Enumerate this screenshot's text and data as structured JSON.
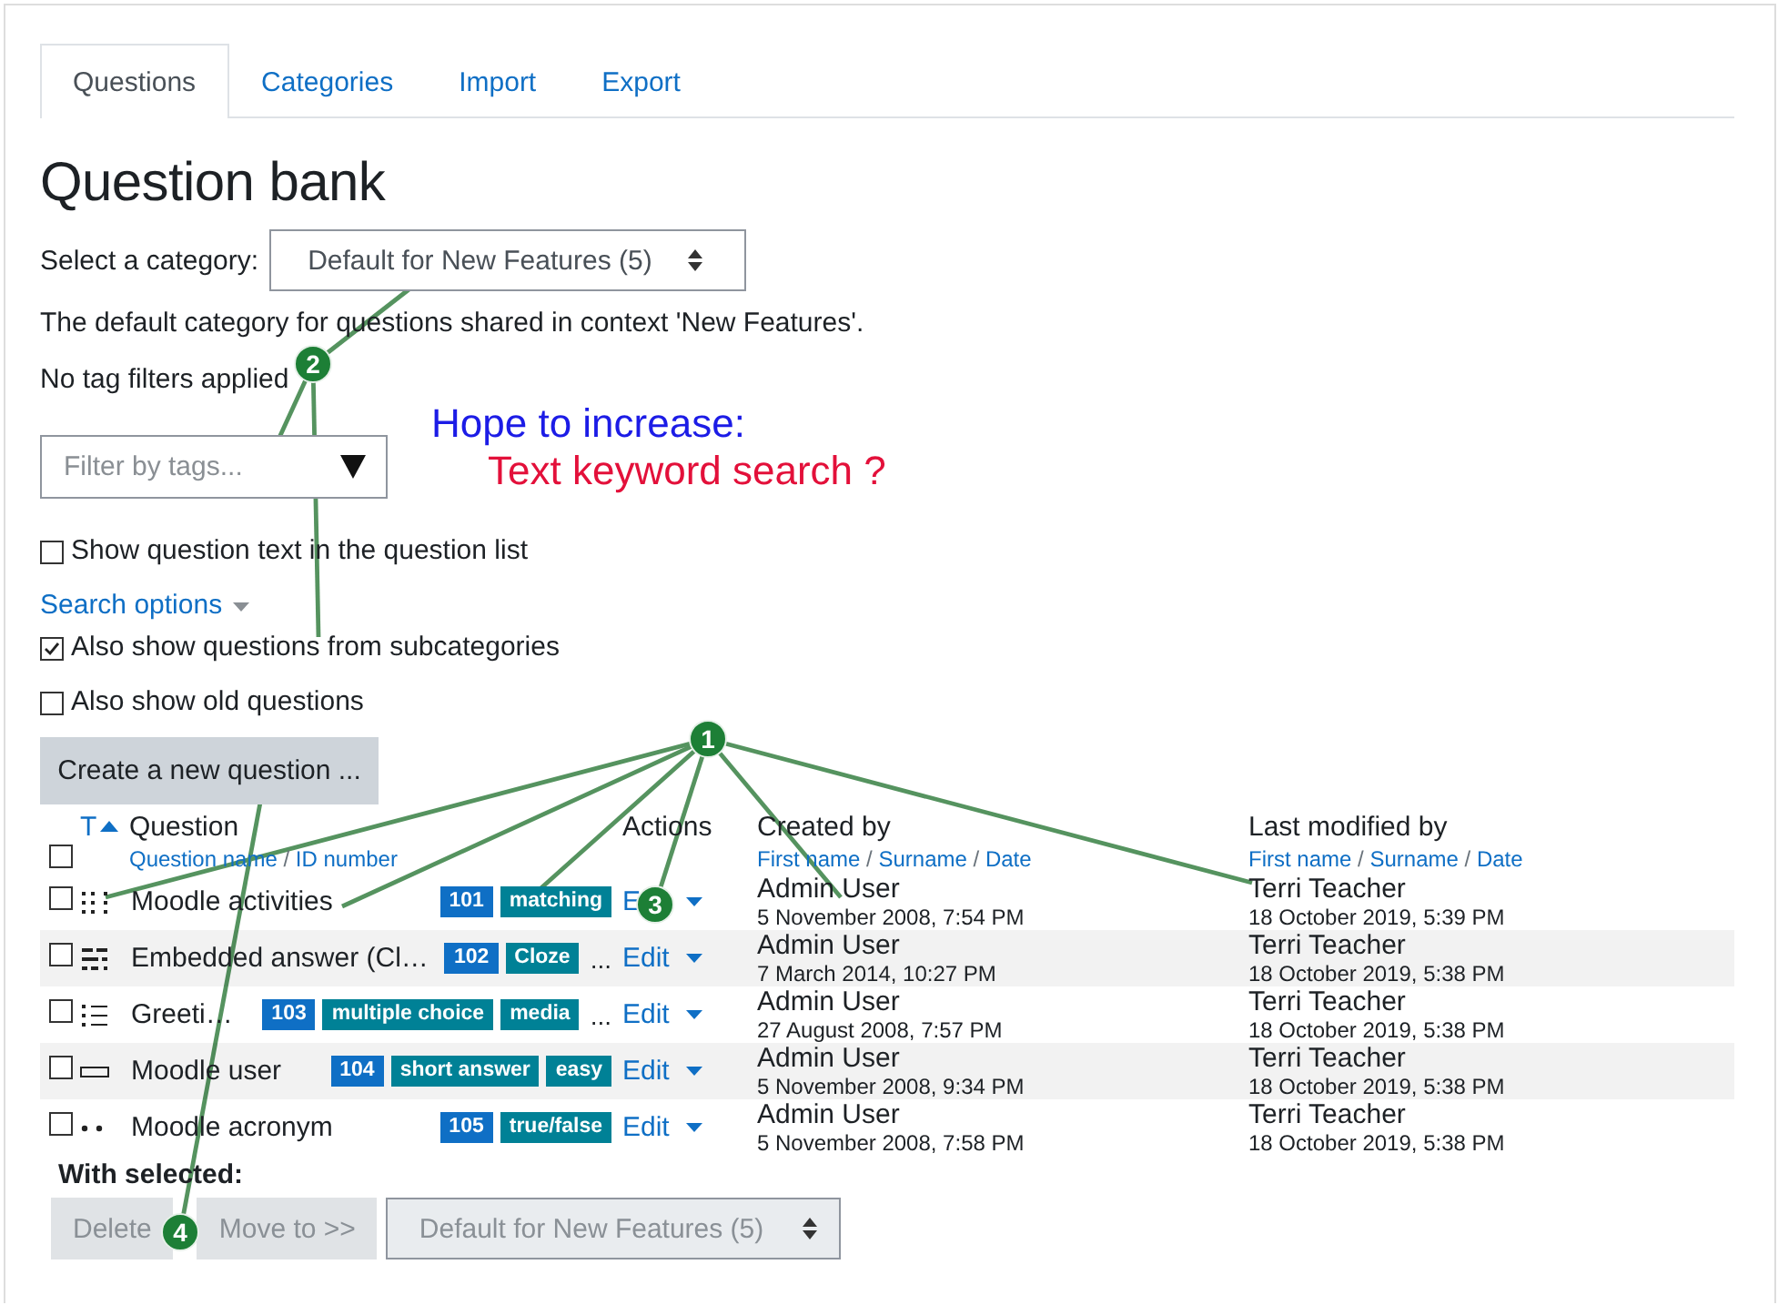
{
  "tabs": [
    {
      "label": "Questions",
      "selected": true
    },
    {
      "label": "Categories",
      "selected": false
    },
    {
      "label": "Import",
      "selected": false
    },
    {
      "label": "Export",
      "selected": false
    }
  ],
  "title": "Question bank",
  "category_select": {
    "label": "Select a category:",
    "value": "Default for New Features (5)"
  },
  "category_description": "The default category for questions shared in context 'New Features'.",
  "tag_filter_status": "No tag filters applied",
  "tag_filter": {
    "placeholder": "Filter by tags..."
  },
  "show_text_option": {
    "label": "Show question text in the question list",
    "checked": false
  },
  "search_options_link": "Search options",
  "search_options": [
    {
      "label": "Also show questions from subcategories",
      "checked": true
    },
    {
      "label": "Also show old questions",
      "checked": false
    }
  ],
  "create_button": "Create a new question ...",
  "table": {
    "select_all": {
      "checked": false
    },
    "type_column": "T",
    "question_column": {
      "label": "Question",
      "sort_links": [
        "Question name",
        "ID number"
      ]
    },
    "actions_column": "Actions",
    "created_column": {
      "label": "Created by",
      "sort_links": [
        "First name",
        "Surname",
        "Date"
      ]
    },
    "modified_column": {
      "label": "Last modified by",
      "sort_links": [
        "First name",
        "Surname",
        "Date"
      ]
    },
    "separator": "/",
    "rows": [
      {
        "checked": false,
        "kind": "matching",
        "name": "Moodle activities",
        "id_number": "101",
        "tags": [
          "matching"
        ],
        "more": "",
        "action": "E",
        "created_by": "Admin User",
        "created_date": "5 November 2008, 7:54 PM",
        "modified_by": "Terri Teacher",
        "modified_date": "18 October 2019, 5:39 PM"
      },
      {
        "checked": false,
        "kind": "cloze",
        "name": "Embedded answer (Cl…",
        "id_number": "102",
        "tags": [
          "Cloze"
        ],
        "more": "...",
        "action": "Edit",
        "created_by": "Admin User",
        "created_date": "7 March 2014, 10:27 PM",
        "modified_by": "Terri Teacher",
        "modified_date": "18 October 2019, 5:38 PM"
      },
      {
        "checked": false,
        "kind": "multichoice",
        "name": "Greeti…",
        "id_number": "103",
        "tags": [
          "multiple choice",
          "media"
        ],
        "more": "...",
        "action": "Edit",
        "created_by": "Admin User",
        "created_date": "27 August 2008, 7:57 PM",
        "modified_by": "Terri Teacher",
        "modified_date": "18 October 2019, 5:38 PM"
      },
      {
        "checked": false,
        "kind": "shortanswer",
        "name": "Moodle user",
        "id_number": "104",
        "tags": [
          "short answer",
          "easy"
        ],
        "more": "",
        "action": "Edit",
        "created_by": "Admin User",
        "created_date": "5 November 2008, 9:34 PM",
        "modified_by": "Terri Teacher",
        "modified_date": "18 October 2019, 5:38 PM"
      },
      {
        "checked": false,
        "kind": "truefalse",
        "name": "Moodle acronym",
        "id_number": "105",
        "tags": [
          "true/false"
        ],
        "more": "",
        "action": "Edit",
        "created_by": "Admin User",
        "created_date": "5 November 2008, 7:58 PM",
        "modified_by": "Terri Teacher",
        "modified_date": "18 October 2019, 5:38 PM"
      }
    ]
  },
  "bulk": {
    "label": "With selected:",
    "buttons": [
      {
        "label": "Delete",
        "disabled": true
      },
      {
        "label": "Move to >>",
        "disabled": true
      }
    ],
    "target": {
      "value": "Default for New Features (5)",
      "disabled": true
    }
  },
  "annotations": {
    "markers": [
      "1",
      "2",
      "3",
      "4"
    ],
    "notes": [
      {
        "text": "Hope to increase:",
        "color": "#1c1ce6"
      },
      {
        "text": "Text keyword search ?",
        "color": "#e3103a"
      }
    ]
  }
}
